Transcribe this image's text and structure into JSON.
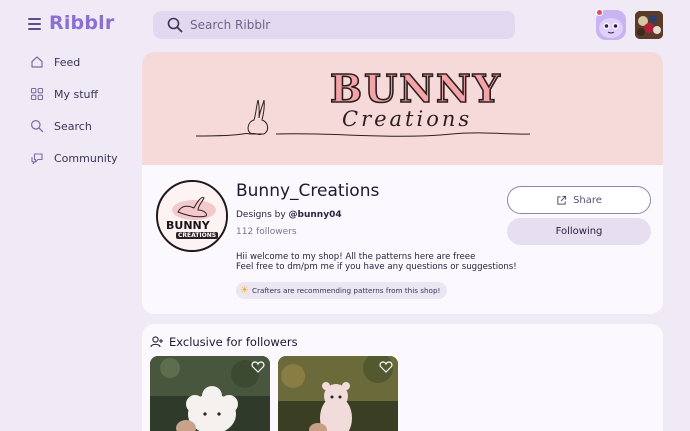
{
  "app": {
    "logo": "Ribblr",
    "search_placeholder": "Search Ribblr"
  },
  "sidebar": {
    "items": [
      {
        "label": "Feed",
        "icon": "home-icon"
      },
      {
        "label": "My stuff",
        "icon": "grid-icon"
      },
      {
        "label": "Search",
        "icon": "search-icon"
      },
      {
        "label": "Community",
        "icon": "chat-bubbles-icon"
      }
    ]
  },
  "banner": {
    "title": "BUNNY",
    "subtitle": "Creations"
  },
  "shop": {
    "avatar_text_main": "BUNNY",
    "avatar_text_sub": "CREATIONS",
    "name": "Bunny_Creations",
    "designs_by_prefix": "Designs by",
    "designer": "@bunny04",
    "followers": "112 followers",
    "bio_line1": "Hii welcome to my shop! All the patterns here are freee",
    "bio_line2": "Feel free to dm/pm me if you have any questions or suggestions!",
    "recommend_badge": "Crafters are recommending patterns from this shop!",
    "share_label": "Share",
    "following_label": "Following"
  },
  "exclusive": {
    "title": "Exclusive for followers",
    "items": [
      {
        "name": "cloud-plush-thumbnail"
      },
      {
        "name": "bear-plush-thumbnail"
      }
    ]
  },
  "colors": {
    "background": "#efeaf6",
    "accent": "#8b6fd1",
    "card": "#fbf9fd",
    "banner": "#f6dad9",
    "notification": "#e2456e"
  }
}
